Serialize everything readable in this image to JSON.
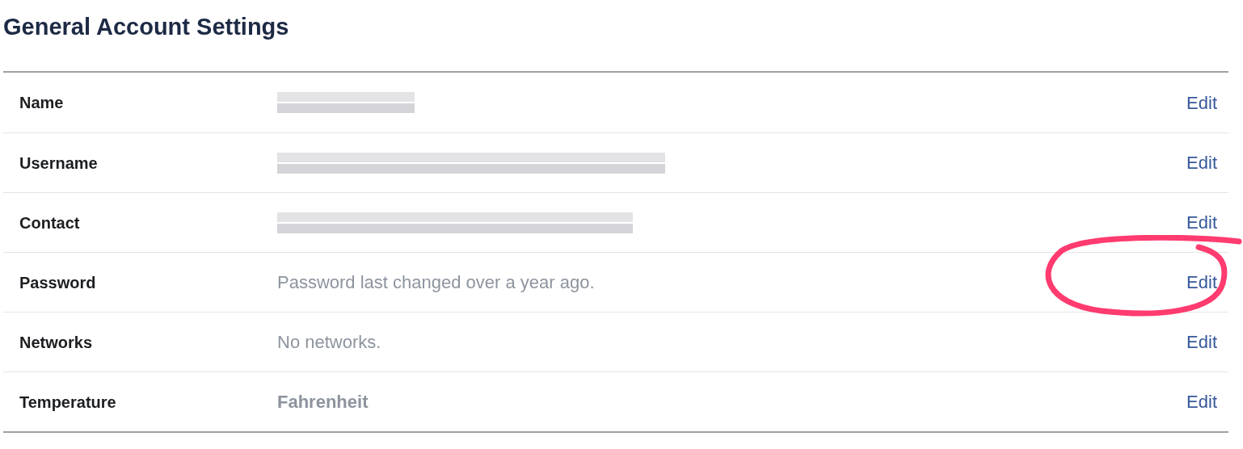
{
  "title": "General Account Settings",
  "rows": [
    {
      "label": "Name",
      "kind": "redacted",
      "action": "Edit",
      "circled": false
    },
    {
      "label": "Username",
      "kind": "redacted",
      "action": "Edit",
      "circled": false
    },
    {
      "label": "Contact",
      "kind": "redacted",
      "action": "Edit",
      "circled": false
    },
    {
      "label": "Password",
      "kind": "text",
      "value": "Password last changed over a year ago.",
      "action": "Edit",
      "circled": true
    },
    {
      "label": "Networks",
      "kind": "text",
      "value": "No networks.",
      "action": "Edit",
      "circled": false
    },
    {
      "label": "Temperature",
      "kind": "bold",
      "value": "Fahrenheit",
      "action": "Edit",
      "circled": false
    }
  ]
}
